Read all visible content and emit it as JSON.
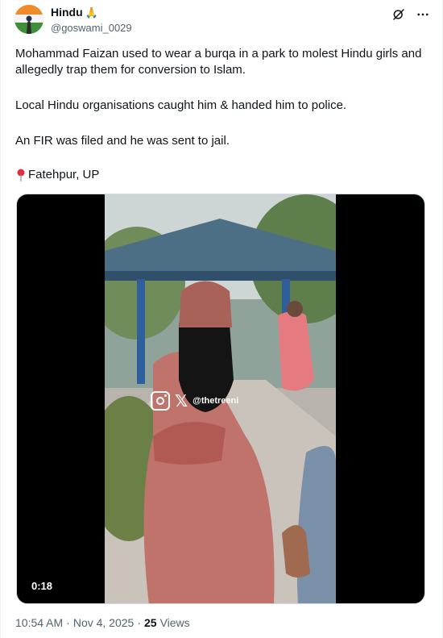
{
  "author": {
    "display_name": "Hindu",
    "name_emoji": "🙏",
    "handle": "@goswami_0029",
    "avatar_icon": "avatar-flag-silhouette"
  },
  "header_actions": {
    "grok_icon": "grok-icon",
    "more_icon": "more-icon",
    "more_label": "···"
  },
  "tweet_text": {
    "line1": "Mohammad Faizan used to wear a burqa in a park to molest Hindu girls and allegedly trap them for conversion to Islam.",
    "line2": "Local Hindu organisations caught him & handed him to police.",
    "line3": "An FIR was filed and he was sent to jail.",
    "location": "Fatehpur, UP",
    "location_icon": "pin-icon"
  },
  "media": {
    "type": "video",
    "duration": "0:18",
    "watermark_handle": "@thetreeni",
    "watermark_x": "𝕏"
  },
  "meta": {
    "time": "10:54 AM",
    "separator": "·",
    "date": "Nov 4, 2025",
    "views_count": "25",
    "views_label": "Views"
  },
  "colors": {
    "text_primary": "#0f1419",
    "text_secondary": "#536471",
    "border": "#eff3f4"
  }
}
